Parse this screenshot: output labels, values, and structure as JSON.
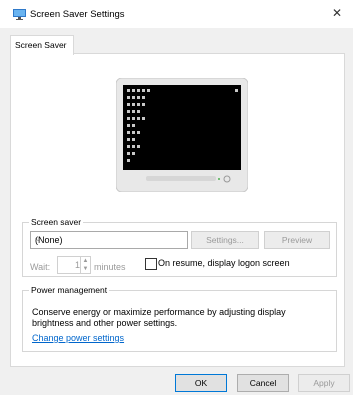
{
  "window": {
    "title": "Screen Saver Settings",
    "close_glyph": "✕"
  },
  "tabs": [
    {
      "label": "Screen Saver"
    }
  ],
  "screen_saver": {
    "group_label": "Screen saver",
    "selected": "(None)",
    "settings_button": "Settings...",
    "preview_button": "Preview",
    "wait_label": "Wait:",
    "wait_value": "1",
    "minutes_label": "minutes",
    "resume_checkbox_label": "On resume, display logon screen"
  },
  "power": {
    "group_label": "Power management",
    "description": "Conserve energy or maximize performance by adjusting display brightness and other power settings.",
    "link": "Change power settings"
  },
  "footer": {
    "ok": "OK",
    "cancel": "Cancel",
    "apply": "Apply"
  }
}
